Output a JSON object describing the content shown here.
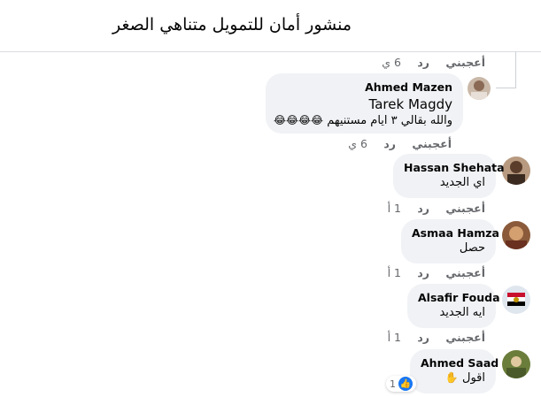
{
  "header": {
    "title": "منشور أمان للتمويل متناهي الصغر"
  },
  "comments": [
    {
      "actions": {
        "like": "أعجبني",
        "reply": "رد",
        "time": "6 ي"
      }
    },
    {
      "author": "Ahmed Mazen",
      "tag": "Tarek Magdy",
      "text": "والله بقالي ٣ ايام مستنيهم",
      "emojis": "😂😂😂😂",
      "actions": {
        "like": "أعجبني",
        "reply": "رد",
        "time": "6 ي"
      }
    },
    {
      "author": "Hassan Shehata",
      "text": "اي الجديد",
      "actions": {
        "like": "أعجبني",
        "reply": "رد",
        "time": "1 أ"
      }
    },
    {
      "author": "Asmaa Hamza",
      "text": "حصل",
      "actions": {
        "like": "أعجبني",
        "reply": "رد",
        "time": "1 أ"
      }
    },
    {
      "author": "Alsafir Fouda",
      "text": "ايه الجديد",
      "actions": {
        "like": "أعجبني",
        "reply": "رد",
        "time": "1 أ"
      }
    },
    {
      "author": "Ahmed Saad",
      "text": "اقول",
      "emoji": "✋",
      "reaction_count": "1"
    }
  ],
  "colors": {
    "bubble": "#f0f2f5",
    "meta": "#65676b",
    "like_blue": "#1877f2"
  }
}
